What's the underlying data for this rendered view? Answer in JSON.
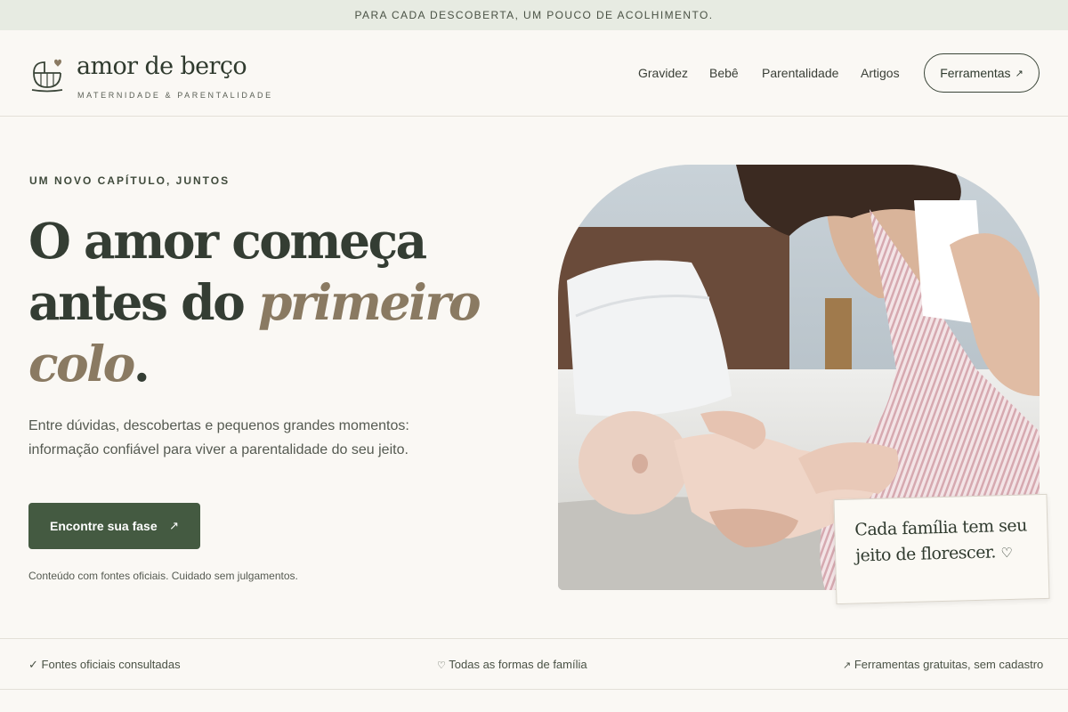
{
  "announcement": "PARA CADA DESCOBERTA, UM POUCO DE ACOLHIMENTO.",
  "brand": {
    "name": "amor de berço",
    "tagline": "MATERNIDADE & PARENTALIDADE",
    "logo_icon": "cradle-heart-icon"
  },
  "nav": {
    "items": [
      "Gravidez",
      "Bebê",
      "Parentalidade",
      "Artigos"
    ],
    "tools_label": "Ferramentas",
    "tools_arrow": "↗"
  },
  "hero": {
    "eyebrow": "UM NOVO CAPÍTULO, JUNTOS",
    "headline_line1": "O amor começa",
    "headline_line2_plain": "antes do",
    "headline_line2_accent": "primeiro",
    "headline_line3_accent": "colo",
    "headline_period": ".",
    "lede": "Entre dúvidas, descobertas e pequenos grandes momentos: informação confiável para viver a parentalidade do seu jeito.",
    "cta_label": "Encontre sua fase",
    "cta_arrow": "↗",
    "note": "Conteúdo com fontes oficiais. Cuidado sem julgamentos.",
    "quote": "Cada família tem seu jeito de florescer.",
    "quote_heart": "♡"
  },
  "features": [
    {
      "icon": "✓",
      "label": "Fontes oficiais consultadas"
    },
    {
      "icon": "♡",
      "label": "Todas as formas de família"
    },
    {
      "icon": "↗",
      "label": "Ferramentas gratuitas, sem cadastro"
    }
  ],
  "colors": {
    "accent_green": "#445a41",
    "accent_tan": "#8a7a62",
    "background": "#faf8f4",
    "topbar": "#e7ebe2"
  }
}
